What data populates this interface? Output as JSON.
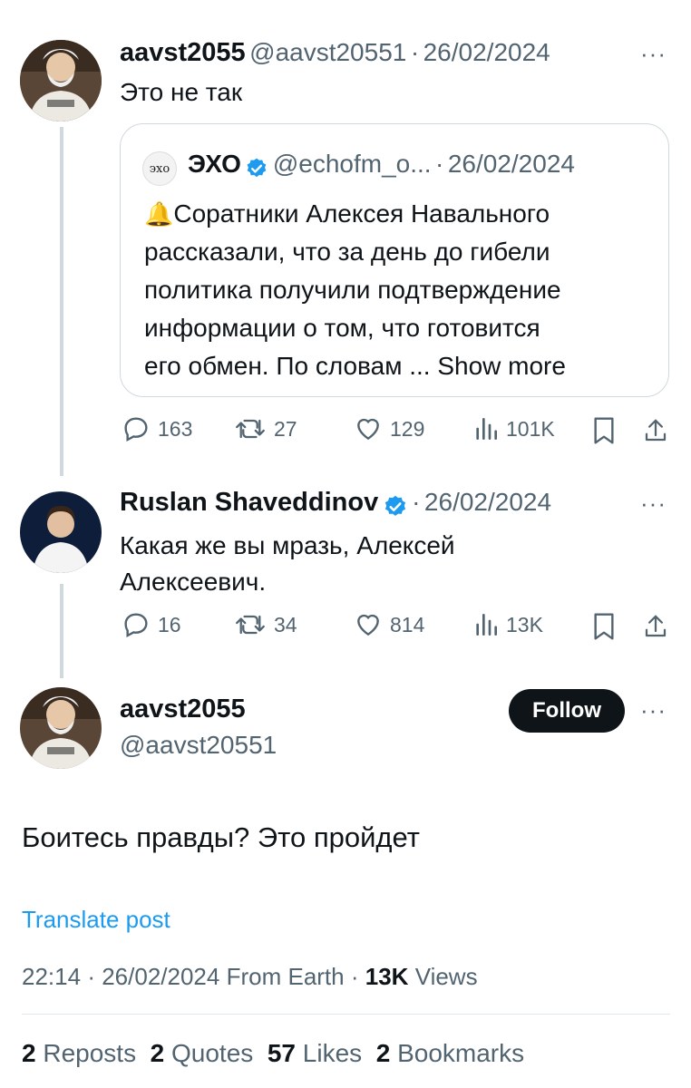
{
  "tweet1": {
    "display_name": "aavst2055",
    "handle": "@aavst20551",
    "sep": "·",
    "date": "26/02/2024",
    "more": "···",
    "text": "Это не так",
    "avatar_shirt_text": "ДЕБИЛЫ",
    "quote": {
      "logo_text": "эхо",
      "display_name": "ЭХО",
      "handle": "@echofm_o...",
      "sep": "·",
      "date": "26/02/2024",
      "bell": "🔔",
      "lines": [
        "Соратники Алексея Навального",
        "рассказали, что за день до гибели",
        "политика получили подтверждение",
        "информации о том, что готовится",
        "его обмен. По словам ... "
      ],
      "show_more": "Show more"
    },
    "stats": {
      "replies": "163",
      "reposts": "27",
      "likes": "129",
      "views": "101K"
    }
  },
  "tweet2": {
    "display_name": "Ruslan Shaveddinov",
    "sep": "·",
    "date": "26/02/2024",
    "more": "···",
    "line1": "Какая же вы мразь, Алексей",
    "line2": "Алексеевич.",
    "stats": {
      "replies": "16",
      "reposts": "34",
      "likes": "814",
      "views": "13K"
    }
  },
  "main": {
    "display_name": "aavst2055",
    "handle": "@aavst20551",
    "follow_label": "Follow",
    "more": "···",
    "text": "Боитесь правды? Это пройдет",
    "translate": "Translate post",
    "time": "22:14",
    "sep1": "·",
    "date": "26/02/2024",
    "from": "From Earth",
    "sep2": "·",
    "views_count": "13K",
    "views_label": "Views",
    "reposts_count": "2",
    "reposts_label": "Reposts",
    "quotes_count": "2",
    "quotes_label": "Quotes",
    "likes_count": "57",
    "likes_label": "Likes",
    "bookmarks_count": "2",
    "bookmarks_label": "Bookmarks"
  },
  "colors": {
    "accent": "#1d9bf0",
    "muted": "#536471",
    "text": "#0f1419",
    "line": "#cfd9de"
  }
}
